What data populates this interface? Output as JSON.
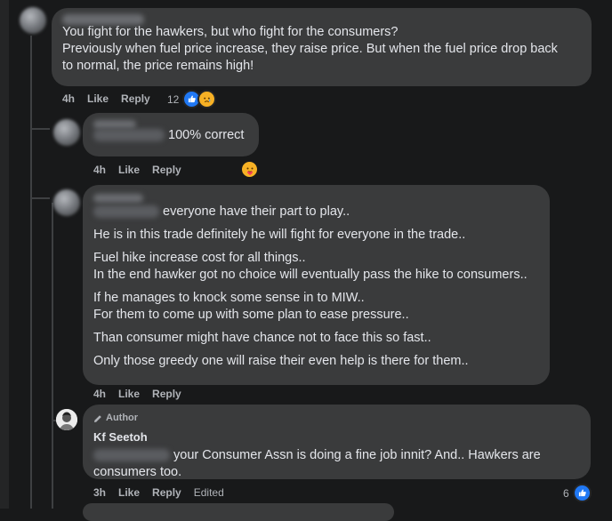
{
  "comments": [
    {
      "text_lines": [
        "You fight for the hawkers, but who fight for the consumers?",
        "Previously when fuel price increase, they raise price. But when the fuel price drop back",
        "to normal, the price remains high!"
      ],
      "time": "4h",
      "like": "Like",
      "reply": "Reply",
      "reaction_count": "12",
      "reaction_icons": [
        "like-icon",
        "sad-icon"
      ]
    },
    {
      "text_suffix": "100% correct",
      "time": "4h",
      "like": "Like",
      "reply": "Reply",
      "reaction_icons": [
        "care-icon"
      ]
    },
    {
      "first_line_suffix": "everyone have their part to play..",
      "paragraphs": [
        [
          "He is in this trade definitely he will fight for everyone in the trade.."
        ],
        [
          "Fuel hike increase cost for all things..",
          "In the end hawker got no choice will eventually pass the hike to consumers.."
        ],
        [
          "If he manages to knock some sense in to MIW..",
          "For them to come up with some plan to ease pressure.."
        ],
        [
          "Than consumer might have chance not to face this so fast.."
        ],
        [
          "Only those greedy one will raise their even help is there for them.."
        ]
      ],
      "time": "4h",
      "like": "Like",
      "reply": "Reply"
    },
    {
      "author_badge": "Author",
      "author_name": "Kf Seetoh",
      "text_suffix": "your Consumer Assn is doing a fine job innit? And.. Hawkers are",
      "text_line2": "consumers too.",
      "time": "3h",
      "like": "Like",
      "reply": "Reply",
      "edited": "Edited",
      "reaction_count": "6",
      "reaction_icons": [
        "like-icon"
      ]
    }
  ],
  "colors": {
    "background": "#18191a",
    "bubble": "#3a3b3c",
    "text": "#e4e6eb",
    "secondary_text": "#b0b3b8",
    "like_blue": "#2078f4",
    "emoji_yellow": "#f7b125"
  }
}
